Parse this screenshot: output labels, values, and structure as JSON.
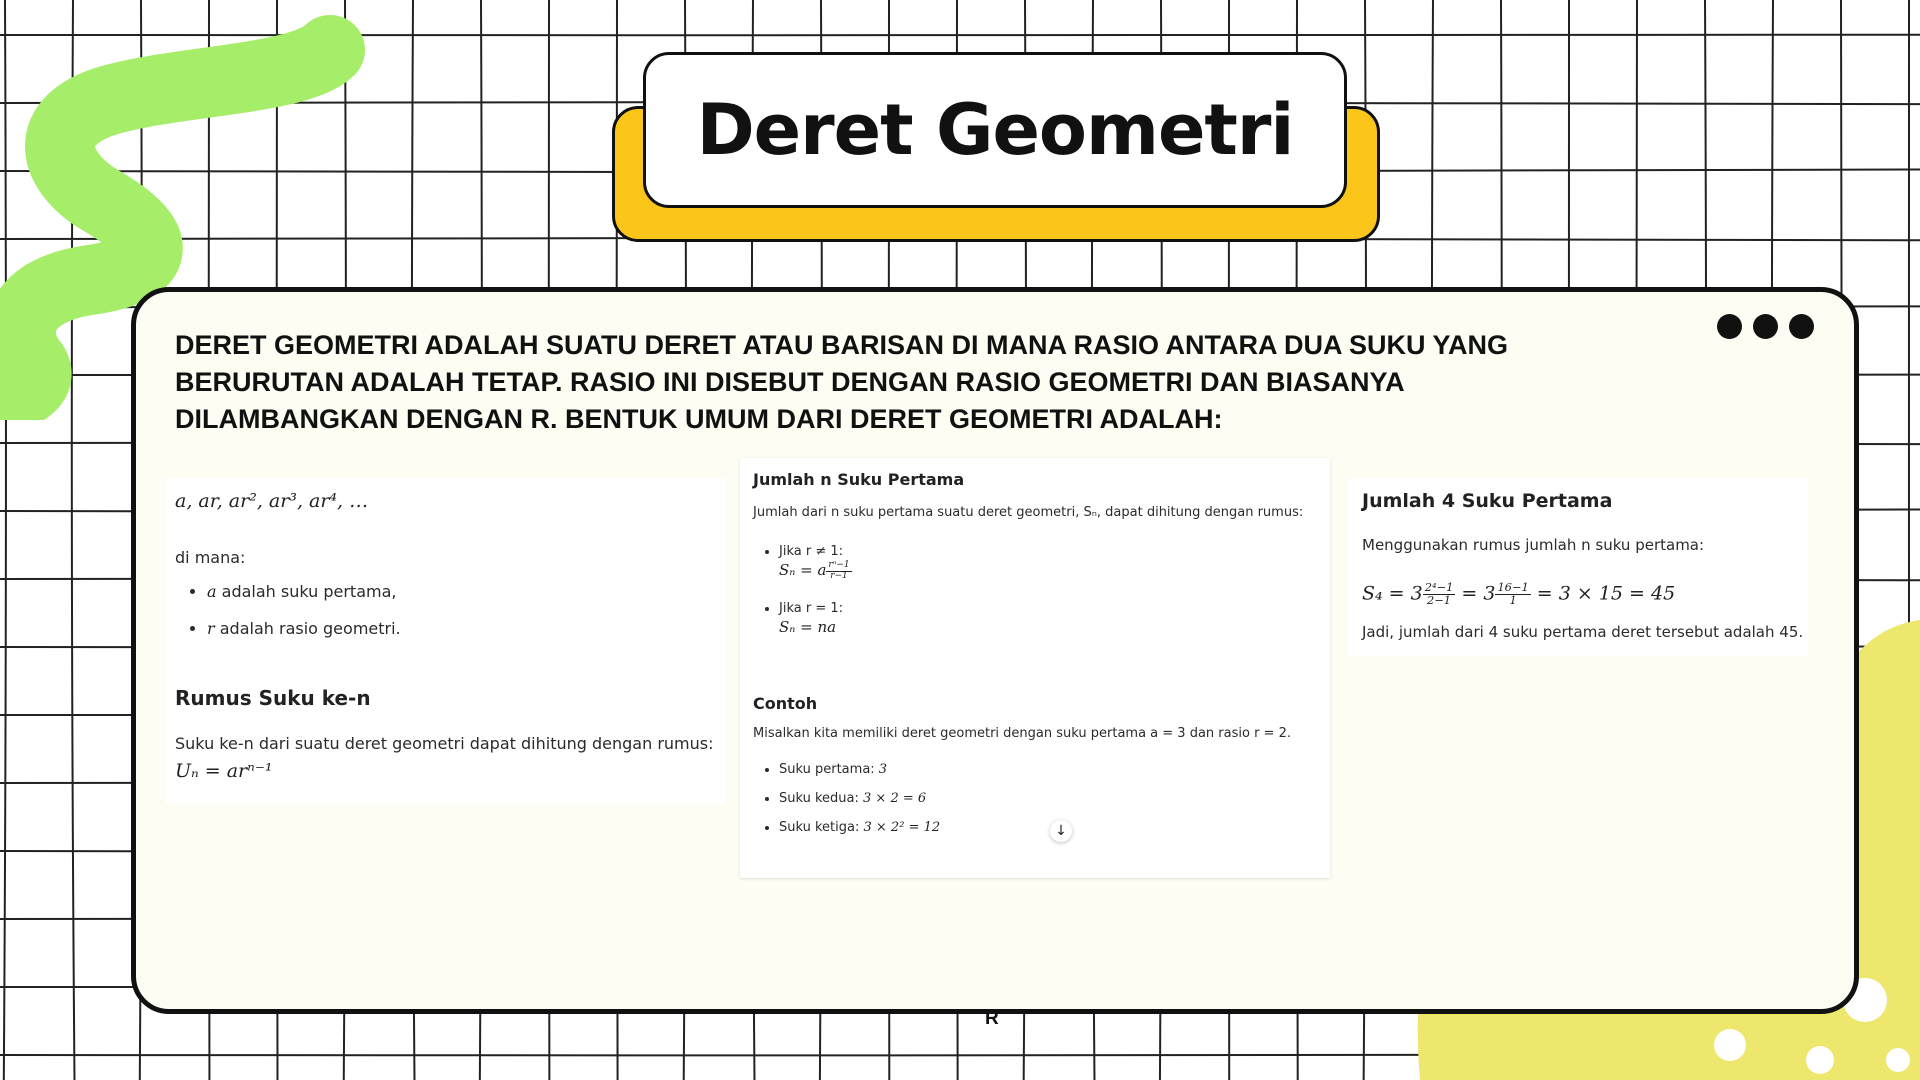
{
  "title": "Deret Geometri",
  "intro": "DERET GEOMETRI ADALAH SUATU DERET ATAU BARISAN DI MANA RASIO ANTARA DUA SUKU YANG BERURUTAN ADALAH TETAP. RASIO INI DISEBUT DENGAN RASIO GEOMETRI DAN BIASANYA DILAMBANGKAN DENGAN R. BENTUK UMUM DARI DERET GEOMETRI ADALAH:",
  "colors": {
    "title_shadow": "#fbc51a",
    "green_blob": "#a6ee6a",
    "yellow_blob": "#ede76e",
    "card_bg": "#fdfdf3"
  },
  "panel1": {
    "sequence": "a, ar, ar², ar³, ar⁴, …",
    "dimana": "di mana:",
    "bullets": [
      {
        "var": "a",
        "text": " adalah suku pertama,"
      },
      {
        "var": "r",
        "text": " adalah rasio geometri."
      }
    ],
    "heading": "Rumus Suku ke-n",
    "rumus_text": "Suku ke-n dari suatu deret geometri dapat dihitung dengan rumus:",
    "formula": "Uₙ = arⁿ⁻¹"
  },
  "panel2": {
    "heading": "Jumlah n Suku Pertama",
    "desc": "Jumlah dari n suku pertama suatu deret geometri, Sₙ, dapat dihitung dengan rumus:",
    "case1_label": "Jika r ≠ 1:",
    "case1_lhs": "Sₙ = a",
    "case1_num": "rⁿ−1",
    "case1_den": "r−1",
    "case2_label": "Jika r = 1:",
    "case2_formula": "Sₙ = na",
    "contoh_heading": "Contoh",
    "contoh_desc": "Misalkan kita memiliki deret geometri dengan suku pertama a = 3 dan rasio r = 2.",
    "examples": [
      {
        "label": "Suku pertama: ",
        "value": "3"
      },
      {
        "label": "Suku kedua: ",
        "value": "3 × 2 = 6"
      },
      {
        "label": "Suku ketiga: ",
        "value": "3 × 2² = 12"
      }
    ],
    "scroll_icon": "↓"
  },
  "panel3": {
    "heading": "Jumlah 4 Suku Pertama",
    "desc": "Menggunakan rumus jumlah n suku pertama:",
    "s4_lhs": "S₄ = 3",
    "frac1_num": "2⁴−1",
    "frac1_den": "2−1",
    "eq_mid": " = 3",
    "frac2_num": "16−1",
    "frac2_den": "1",
    "s4_rhs": " = 3 × 15 = 45",
    "conclusion": "Jadi, jumlah dari 4 suku pertama deret tersebut adalah 45."
  },
  "footer": "R"
}
